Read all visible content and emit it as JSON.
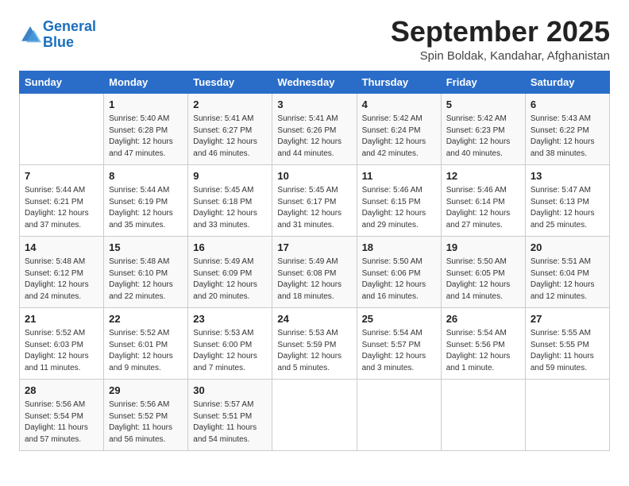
{
  "logo": {
    "line1": "General",
    "line2": "Blue",
    "icon": "▶"
  },
  "title": "September 2025",
  "subtitle": "Spin Boldak, Kandahar, Afghanistan",
  "days_of_week": [
    "Sunday",
    "Monday",
    "Tuesday",
    "Wednesday",
    "Thursday",
    "Friday",
    "Saturday"
  ],
  "weeks": [
    [
      {
        "num": "",
        "info": ""
      },
      {
        "num": "1",
        "info": "Sunrise: 5:40 AM\nSunset: 6:28 PM\nDaylight: 12 hours\nand 47 minutes."
      },
      {
        "num": "2",
        "info": "Sunrise: 5:41 AM\nSunset: 6:27 PM\nDaylight: 12 hours\nand 46 minutes."
      },
      {
        "num": "3",
        "info": "Sunrise: 5:41 AM\nSunset: 6:26 PM\nDaylight: 12 hours\nand 44 minutes."
      },
      {
        "num": "4",
        "info": "Sunrise: 5:42 AM\nSunset: 6:24 PM\nDaylight: 12 hours\nand 42 minutes."
      },
      {
        "num": "5",
        "info": "Sunrise: 5:42 AM\nSunset: 6:23 PM\nDaylight: 12 hours\nand 40 minutes."
      },
      {
        "num": "6",
        "info": "Sunrise: 5:43 AM\nSunset: 6:22 PM\nDaylight: 12 hours\nand 38 minutes."
      }
    ],
    [
      {
        "num": "7",
        "info": "Sunrise: 5:44 AM\nSunset: 6:21 PM\nDaylight: 12 hours\nand 37 minutes."
      },
      {
        "num": "8",
        "info": "Sunrise: 5:44 AM\nSunset: 6:19 PM\nDaylight: 12 hours\nand 35 minutes."
      },
      {
        "num": "9",
        "info": "Sunrise: 5:45 AM\nSunset: 6:18 PM\nDaylight: 12 hours\nand 33 minutes."
      },
      {
        "num": "10",
        "info": "Sunrise: 5:45 AM\nSunset: 6:17 PM\nDaylight: 12 hours\nand 31 minutes."
      },
      {
        "num": "11",
        "info": "Sunrise: 5:46 AM\nSunset: 6:15 PM\nDaylight: 12 hours\nand 29 minutes."
      },
      {
        "num": "12",
        "info": "Sunrise: 5:46 AM\nSunset: 6:14 PM\nDaylight: 12 hours\nand 27 minutes."
      },
      {
        "num": "13",
        "info": "Sunrise: 5:47 AM\nSunset: 6:13 PM\nDaylight: 12 hours\nand 25 minutes."
      }
    ],
    [
      {
        "num": "14",
        "info": "Sunrise: 5:48 AM\nSunset: 6:12 PM\nDaylight: 12 hours\nand 24 minutes."
      },
      {
        "num": "15",
        "info": "Sunrise: 5:48 AM\nSunset: 6:10 PM\nDaylight: 12 hours\nand 22 minutes."
      },
      {
        "num": "16",
        "info": "Sunrise: 5:49 AM\nSunset: 6:09 PM\nDaylight: 12 hours\nand 20 minutes."
      },
      {
        "num": "17",
        "info": "Sunrise: 5:49 AM\nSunset: 6:08 PM\nDaylight: 12 hours\nand 18 minutes."
      },
      {
        "num": "18",
        "info": "Sunrise: 5:50 AM\nSunset: 6:06 PM\nDaylight: 12 hours\nand 16 minutes."
      },
      {
        "num": "19",
        "info": "Sunrise: 5:50 AM\nSunset: 6:05 PM\nDaylight: 12 hours\nand 14 minutes."
      },
      {
        "num": "20",
        "info": "Sunrise: 5:51 AM\nSunset: 6:04 PM\nDaylight: 12 hours\nand 12 minutes."
      }
    ],
    [
      {
        "num": "21",
        "info": "Sunrise: 5:52 AM\nSunset: 6:03 PM\nDaylight: 12 hours\nand 11 minutes."
      },
      {
        "num": "22",
        "info": "Sunrise: 5:52 AM\nSunset: 6:01 PM\nDaylight: 12 hours\nand 9 minutes."
      },
      {
        "num": "23",
        "info": "Sunrise: 5:53 AM\nSunset: 6:00 PM\nDaylight: 12 hours\nand 7 minutes."
      },
      {
        "num": "24",
        "info": "Sunrise: 5:53 AM\nSunset: 5:59 PM\nDaylight: 12 hours\nand 5 minutes."
      },
      {
        "num": "25",
        "info": "Sunrise: 5:54 AM\nSunset: 5:57 PM\nDaylight: 12 hours\nand 3 minutes."
      },
      {
        "num": "26",
        "info": "Sunrise: 5:54 AM\nSunset: 5:56 PM\nDaylight: 12 hours\nand 1 minute."
      },
      {
        "num": "27",
        "info": "Sunrise: 5:55 AM\nSunset: 5:55 PM\nDaylight: 11 hours\nand 59 minutes."
      }
    ],
    [
      {
        "num": "28",
        "info": "Sunrise: 5:56 AM\nSunset: 5:54 PM\nDaylight: 11 hours\nand 57 minutes."
      },
      {
        "num": "29",
        "info": "Sunrise: 5:56 AM\nSunset: 5:52 PM\nDaylight: 11 hours\nand 56 minutes."
      },
      {
        "num": "30",
        "info": "Sunrise: 5:57 AM\nSunset: 5:51 PM\nDaylight: 11 hours\nand 54 minutes."
      },
      {
        "num": "",
        "info": ""
      },
      {
        "num": "",
        "info": ""
      },
      {
        "num": "",
        "info": ""
      },
      {
        "num": "",
        "info": ""
      }
    ]
  ]
}
